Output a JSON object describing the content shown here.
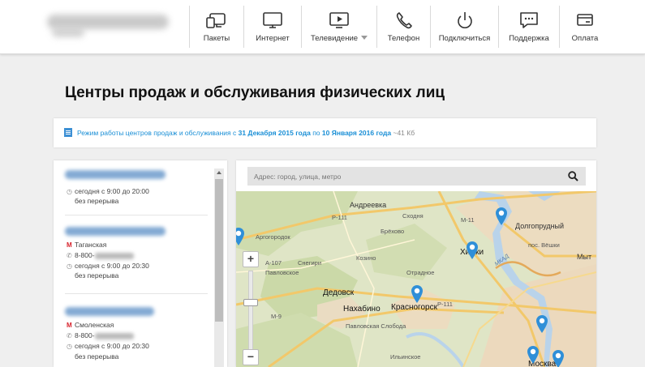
{
  "header": {
    "nav": [
      {
        "label": "Пакеты",
        "icon": "bundle-icon"
      },
      {
        "label": "Интернет",
        "icon": "monitor-icon"
      },
      {
        "label": "Телевидение",
        "icon": "tv-icon",
        "dropdown": true
      },
      {
        "label": "Телефон",
        "icon": "phone-icon"
      },
      {
        "label": "Подключиться",
        "icon": "power-icon"
      },
      {
        "label": "Поддержка",
        "icon": "chat-icon"
      },
      {
        "label": "Оплата",
        "icon": "card-icon"
      }
    ]
  },
  "page": {
    "title": "Центры продаж и обслуживания физических лиц"
  },
  "notice": {
    "prefix": "Режим работы центров продаж и обслуживания с ",
    "date_from": "31 Декабря 2015 года",
    "middle": " по ",
    "date_to": "10 Января 2016 года",
    "size": " ~41 Кб"
  },
  "offices": [
    {
      "hours": "сегодня с 9:00 до 20:00",
      "break": "без перерыва"
    },
    {
      "metro": "Таганская",
      "phone_prefix": "8-800-",
      "hours": "сегодня с 9:00 до 20:30",
      "break": "без перерыва"
    },
    {
      "metro": "Смоленская",
      "phone_prefix": "8-800-",
      "hours": "сегодня с 9:00 до 20:30",
      "break": "без перерыва"
    }
  ],
  "search": {
    "placeholder": "Адрес: город, улица, метро"
  },
  "map": {
    "labels": [
      "Андреевка",
      "Р-111",
      "Сходня",
      "М-11",
      "Долгопрудный",
      "Аргогородок",
      "Брёхово",
      "пос. Вёшки",
      "А-107",
      "Снегири",
      "Козино",
      "Химки",
      "МКАД",
      "Мыт",
      "Павловское",
      "Отрадное",
      "Дедовск",
      "Нахабино",
      "Красногорск",
      "Р-111",
      "М-9",
      "Павловская Слобода",
      "Москва",
      "Ильинское"
    ],
    "zoom_in": "+",
    "zoom_out": "−"
  },
  "colors": {
    "link": "#1a8fd6",
    "metro": "#d6212b",
    "pin": "#2f8fd8"
  }
}
